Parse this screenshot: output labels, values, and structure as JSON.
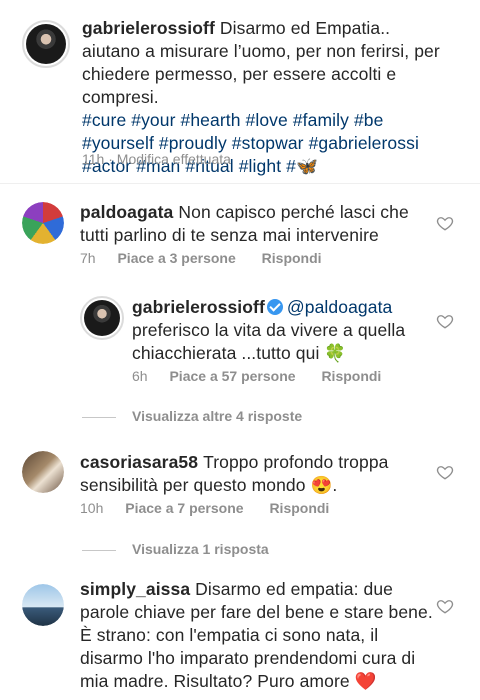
{
  "caption": {
    "username": "gabrielerossioff",
    "text": "Disarmo ed Empatia.. aiutano a misurare l’uomo, per non ferirsi, per chiedere permesso, per essere accolti e compresi.",
    "hashtags": [
      "#cure",
      "#your",
      "#hearth",
      "#love",
      "#family",
      "#be",
      "#yourself",
      "#proudly",
      "#stopwar",
      "#gabrielerossi",
      "#actor",
      "#man",
      "#ritual",
      "#light",
      "#🦋"
    ],
    "time": "11h",
    "edited": "Modifica effettuata"
  },
  "comments": [
    {
      "username": "paldoagata",
      "text": "Non capisco perché lasci che tutti parlino di te senza mai intervenire",
      "time": "7h",
      "likes": "Piace a 3 persone",
      "reply": "Rispondi"
    },
    {
      "username": "gabrielerossioff",
      "mention": "@paldoagata",
      "text": "preferisco la vita da vivere a quella chiacchierata ...tutto qui 🍀",
      "time": "6h",
      "likes": "Piace a 57 persone",
      "reply": "Rispondi"
    },
    {
      "username": "casoriasara58",
      "text": "Troppo profondo troppa sensibilità per questo mondo 😍.",
      "time": "10h",
      "likes": "Piace a 7 persone",
      "reply": "Rispondi"
    },
    {
      "username": "simply_aissa",
      "text": "Disarmo ed empatia: due parole chiave per fare del bene e stare bene. È strano: con l'empatia ci sono nata, il disarmo l'ho imparato prendendomi cura di mia madre. Risultato? Puro amore ❤️"
    }
  ],
  "view_replies": [
    "Visualizza altre 4 risposte",
    "Visualizza 1 risposta"
  ],
  "colors": {
    "link": "#00376b",
    "verified": "#3897f0",
    "meta": "#8e8e8e"
  }
}
